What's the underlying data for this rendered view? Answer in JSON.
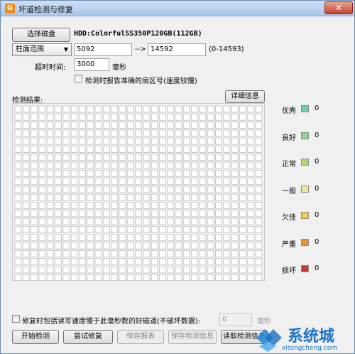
{
  "window": {
    "title": "坏道检测与修复",
    "close": "✕"
  },
  "toolbar": {
    "select_disk": "选择磁盘",
    "drive": "HDD:ColorfulSS350P120GB(112GB)"
  },
  "range": {
    "mode": "柱面范围",
    "start": "5092",
    "arrow": "-->",
    "end": "14592",
    "hint": "(0-14593)"
  },
  "timeout": {
    "label": "超时时间:",
    "value": "3000",
    "unit": "毫秒"
  },
  "report_sector": {
    "label": "检测时报告准确的扇区号(速度较慢)"
  },
  "results": {
    "label": "检测结果:",
    "detail_button": "详细信息"
  },
  "grid": {
    "cols": 31,
    "rows": 22,
    "cell_color": "#ffffff",
    "border_color": "#c9c9c9"
  },
  "legend": [
    {
      "label": "优秀",
      "color": "#6fcfa5",
      "count": "0"
    },
    {
      "label": "良好",
      "color": "#8ed88c",
      "count": "0"
    },
    {
      "label": "正常",
      "color": "#b5d871",
      "count": "0"
    },
    {
      "label": "一般",
      "color": "#efe89a",
      "count": "0"
    },
    {
      "label": "欠佳",
      "color": "#f4cf3c",
      "count": "0"
    },
    {
      "label": "严重",
      "color": "#e9932e",
      "count": "0"
    },
    {
      "label": "损坏",
      "color": "#c4393a",
      "count": "0"
    }
  ],
  "repair_option": {
    "label": "修复时包括读写速度慢于此毫秒数的好磁道(不破坏数据):",
    "value": "0",
    "unit": "毫秒"
  },
  "bottom_buttons": {
    "start": "开始检测",
    "repair": "尝试修复",
    "save_report": "保存报表",
    "save_info": "保存检测信息",
    "read_info": "读取检测信息"
  },
  "watermark": {
    "brand": "系统城",
    "url": "xitongcheng.com"
  }
}
